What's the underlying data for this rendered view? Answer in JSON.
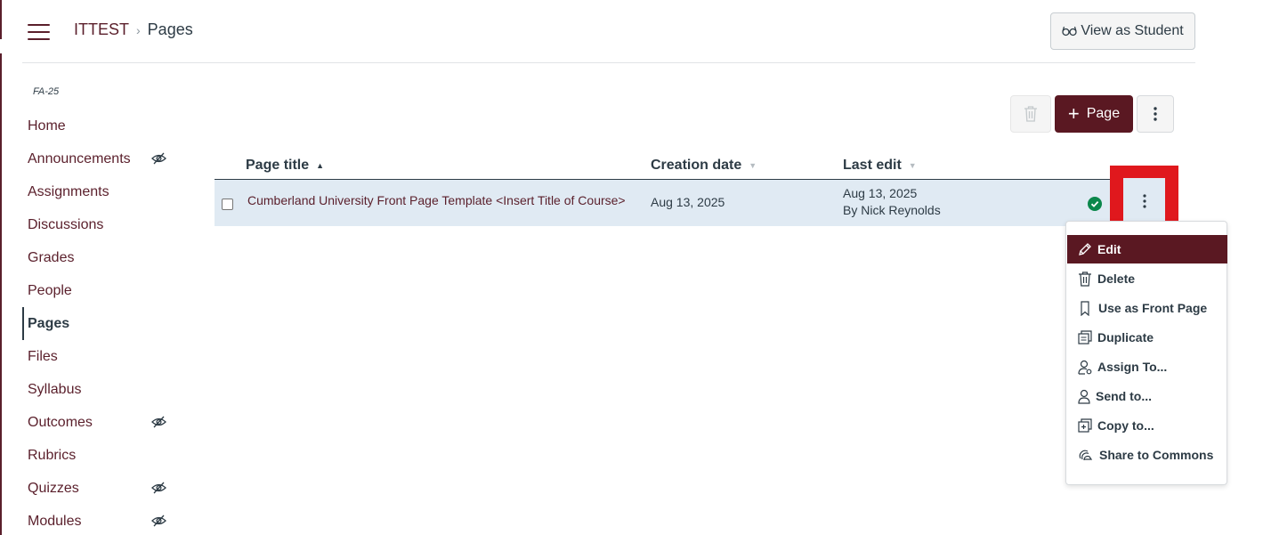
{
  "header": {
    "breadcrumb": [
      "ITTEST",
      "Pages"
    ],
    "view_as_student": "View as Student"
  },
  "sidebar": {
    "term": "FA-25",
    "items": [
      {
        "label": "Home",
        "hidden": false
      },
      {
        "label": "Announcements",
        "hidden": true
      },
      {
        "label": "Assignments",
        "hidden": false
      },
      {
        "label": "Discussions",
        "hidden": false
      },
      {
        "label": "Grades",
        "hidden": false
      },
      {
        "label": "People",
        "hidden": false
      },
      {
        "label": "Pages",
        "hidden": false,
        "active": true
      },
      {
        "label": "Files",
        "hidden": false
      },
      {
        "label": "Syllabus",
        "hidden": false
      },
      {
        "label": "Outcomes",
        "hidden": true
      },
      {
        "label": "Rubrics",
        "hidden": false
      },
      {
        "label": "Quizzes",
        "hidden": true
      },
      {
        "label": "Modules",
        "hidden": true
      }
    ]
  },
  "toolbar": {
    "add_page_label": "Page"
  },
  "table": {
    "columns": [
      "Page title",
      "Creation date",
      "Last edit"
    ],
    "rows": [
      {
        "title": "Cumberland University Front Page Template <Insert Title of Course>",
        "creation_date": "Aug 13, 2025",
        "last_edit_date": "Aug 13, 2025",
        "last_edit_by": "By Nick Reynolds",
        "published": true
      }
    ]
  },
  "menu": {
    "items": [
      {
        "label": "Edit",
        "icon": "pencil-icon",
        "selected": true
      },
      {
        "label": "Delete",
        "icon": "trash-icon"
      },
      {
        "label": "Use as Front Page",
        "icon": "bookmark-icon"
      },
      {
        "label": "Duplicate",
        "icon": "duplicate-icon"
      },
      {
        "label": "Assign To...",
        "icon": "user-settings-icon"
      },
      {
        "label": "Send to...",
        "icon": "user-icon"
      },
      {
        "label": "Copy to...",
        "icon": "copy-to-icon"
      },
      {
        "label": "Share to Commons",
        "icon": "commons-icon"
      }
    ]
  },
  "colors": {
    "brand": "#5a1822",
    "link": "#5a1f2b",
    "row_highlight": "#e0eaf3",
    "published": "#0b874b",
    "annotation": "#e0181d"
  }
}
